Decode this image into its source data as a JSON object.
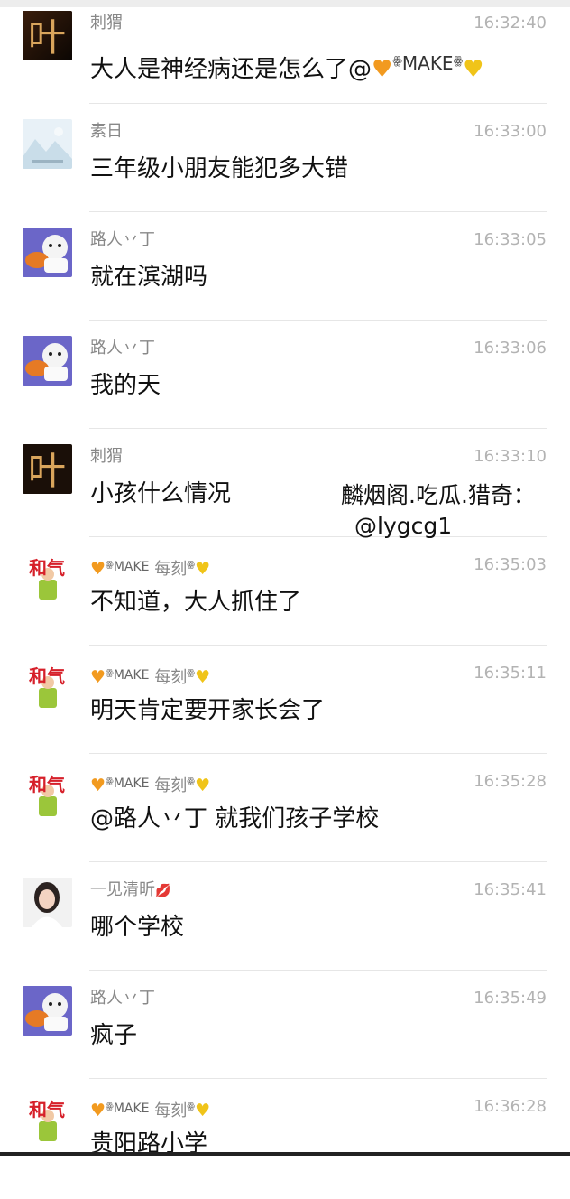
{
  "messages": [
    {
      "name": "刺猬",
      "time": "16:32:40",
      "text": "大人是神经病还是怎么了@",
      "mention": "MAKE"
    },
    {
      "name": "素日",
      "time": "16:33:00",
      "text": "三年级小朋友能犯多大错"
    },
    {
      "name": "路人丷丁",
      "time": "16:33:05",
      "text": "就在滨湖吗"
    },
    {
      "name": "路人丷丁",
      "time": "16:33:06",
      "text": "我的天"
    },
    {
      "name": "刺猬",
      "time": "16:33:10",
      "text": "小孩什么情况"
    },
    {
      "name_make": "MAKE",
      "name": "每刻",
      "time": "16:35:03",
      "text": "不知道，大人抓住了"
    },
    {
      "name_make": "MAKE",
      "name": "每刻",
      "time": "16:35:11",
      "text": "明天肯定要开家长会了"
    },
    {
      "name_make": "MAKE",
      "name": "每刻",
      "time": "16:35:28",
      "text": "@路人丷丁 就我们孩子学校"
    },
    {
      "name": "一见清昕",
      "time": "16:35:41",
      "text": "哪个学校"
    },
    {
      "name": "路人丷丁",
      "time": "16:35:49",
      "text": "疯子"
    },
    {
      "name_make": "MAKE",
      "name": "每刻",
      "time": "16:36:28",
      "text": "贵阳路小学"
    }
  ],
  "avatar_text": {
    "ye": "叶",
    "heti": "和气"
  },
  "watermark": {
    "line1": "麟烟阁.吃瓜.猎奇：",
    "line2": "@lygcg1"
  },
  "colors": {
    "name_gray": "#888888",
    "time_gray": "#b3b3b3",
    "heart_orange": "#f29a1f",
    "heart_yellow": "#f0c419"
  }
}
